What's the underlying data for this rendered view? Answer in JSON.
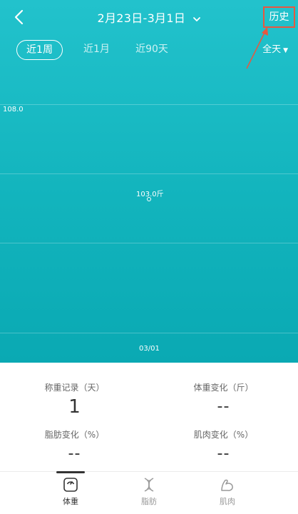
{
  "header": {
    "date_range": "2月23日-3月1日",
    "history_label": "历史"
  },
  "tabs": [
    {
      "label": "近1周",
      "active": true
    },
    {
      "label": "近1月",
      "active": false
    },
    {
      "label": "近90天",
      "active": false
    }
  ],
  "filter": {
    "label": "全天"
  },
  "chart_data": {
    "type": "scatter",
    "ytick_label": "108.0",
    "points": [
      {
        "x": "03/01",
        "y": 103.0,
        "label": "103.0斤"
      }
    ]
  },
  "stats": [
    {
      "label": "称重记录（天）",
      "value": "1"
    },
    {
      "label": "体重变化（斤）",
      "value": "--"
    },
    {
      "label": "脂肪变化（%）",
      "value": "--"
    },
    {
      "label": "肌肉变化（%）",
      "value": "--"
    }
  ],
  "bottom_nav": [
    {
      "label": "体重",
      "icon": "scale-icon",
      "active": true
    },
    {
      "label": "脂肪",
      "icon": "dna-icon",
      "active": false
    },
    {
      "label": "肌肉",
      "icon": "arm-muscle-icon",
      "active": false
    }
  ],
  "colors": {
    "accent": "#12b4bd",
    "annotation": "#e9573f"
  }
}
